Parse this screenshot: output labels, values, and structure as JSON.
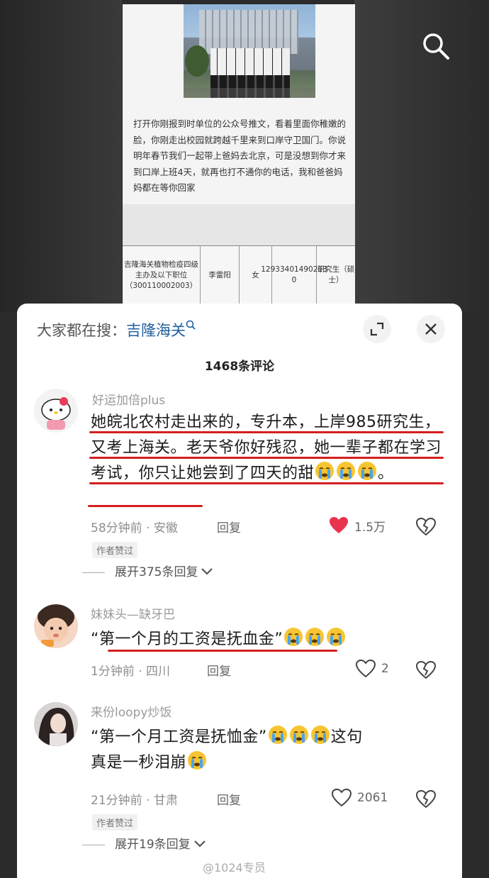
{
  "document": {
    "paragraph": "打开你刚报到时单位的公众号推文，看着里面你稚嫩的脸，你刚走出校园就跨越千里来到口岸守卫国门。你说明年春节我们一起带上爸妈去北京，可是没想到你才来到口岸上班4天，就再也打不通你的电话，我和爸爸妈妈都在等你回家",
    "table": {
      "position": "吉隆海关植物检疫四级主办及以下职位（300110002003）",
      "name": "李雷阳",
      "gender": "女",
      "id_number": "12933401490213 0",
      "education": "研究生（硕士）"
    }
  },
  "header": {
    "search_prefix": "大家都在搜：",
    "search_query": "吉隆海关"
  },
  "comment_count": "1468条评论",
  "comments": [
    {
      "username": "好运加倍plus",
      "text": "她皖北农村走出来的，专升本，上岸985研究生，又考上海关。老天爷你好残忍，她一辈子都在学习考试，你只让她尝到了四天的甜",
      "text_tail": "。",
      "emojis": 3,
      "time_location": "58分钟前 · 安徽",
      "reply_label": "回复",
      "likes": "1.5万",
      "liked": true,
      "author_tag": "作者赞过",
      "expand_label": "展开375条回复"
    },
    {
      "username": "妹妹头—缺牙巴",
      "text": "“第一个月的工资是抚血金”",
      "emojis": 3,
      "time_location": "1分钟前 · 四川",
      "reply_label": "回复",
      "likes": "2",
      "liked": false
    },
    {
      "username": "来份loopy炒饭",
      "text_before": "“第一个月工资是抚恤金”",
      "text_after": "这句",
      "text_line2": "真是一秒泪崩",
      "emojis": 3,
      "time_location": "21分钟前 · 甘肃",
      "reply_label": "回复",
      "likes": "2061",
      "liked": false,
      "author_tag": "作者赞过",
      "expand_label": "展开19条回复"
    }
  ],
  "watermark": "@1024专员",
  "colors": {
    "accent_blue": "#1f5e9e",
    "like_red": "#e8344e",
    "underline_red": "#d42020"
  },
  "icons": [
    "search-icon",
    "expand-icon",
    "close-icon",
    "heart-icon",
    "broken-heart-icon",
    "chevron-down-icon",
    "crying-emoji"
  ]
}
